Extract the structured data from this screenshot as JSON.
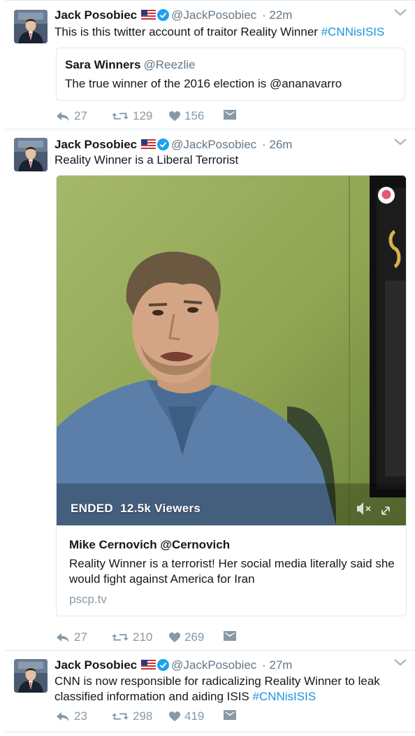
{
  "tweets": [
    {
      "author_name": "Jack Posobiec",
      "handle": "@JackPosobiec",
      "time": "· 22m",
      "text_prefix": "This is this twitter account of traitor Reality Winner ",
      "hashtag": "#CNNisISIS",
      "quote": {
        "name": "Sara Winners",
        "handle": "@Reezlie",
        "text": "The true winner of the 2016 election is @ananavarro"
      },
      "replies": "27",
      "retweets": "129",
      "likes": "156"
    },
    {
      "author_name": "Jack Posobiec",
      "handle": "@JackPosobiec",
      "time": "· 26m",
      "text": "Reality Winner is a Liberal Terrorist",
      "card": {
        "video_status": "ENDED",
        "viewers": "12.5k Viewers",
        "title": "Mike Cernovich @Cernovich",
        "description": "Reality Winner is a terrorist! Her social media literally said she would fight against America for Iran",
        "domain": "pscp.tv"
      },
      "replies": "27",
      "retweets": "210",
      "likes": "269"
    },
    {
      "author_name": "Jack Posobiec",
      "handle": "@JackPosobiec",
      "time": "· 27m",
      "text_prefix": "CNN is now responsible for radicalizing Reality Winner to leak classified information and aiding ISIS ",
      "hashtag": "#CNNisISIS",
      "replies": "23",
      "retweets": "298",
      "likes": "419"
    }
  ],
  "icons": {
    "reply": "reply-icon",
    "retweet": "retweet-icon",
    "like": "heart-icon",
    "message": "direct-message-icon",
    "verified": "verified-badge-icon",
    "flag": "us-flag-icon",
    "caret": "chevron-down-icon",
    "mute": "mute-icon",
    "expand": "expand-icon",
    "periscope": "periscope-icon"
  },
  "colors": {
    "hashtag": "#1b95e0",
    "secondary_text": "#657786",
    "action_icon": "#8899a6",
    "verified": "#1da1f2"
  }
}
